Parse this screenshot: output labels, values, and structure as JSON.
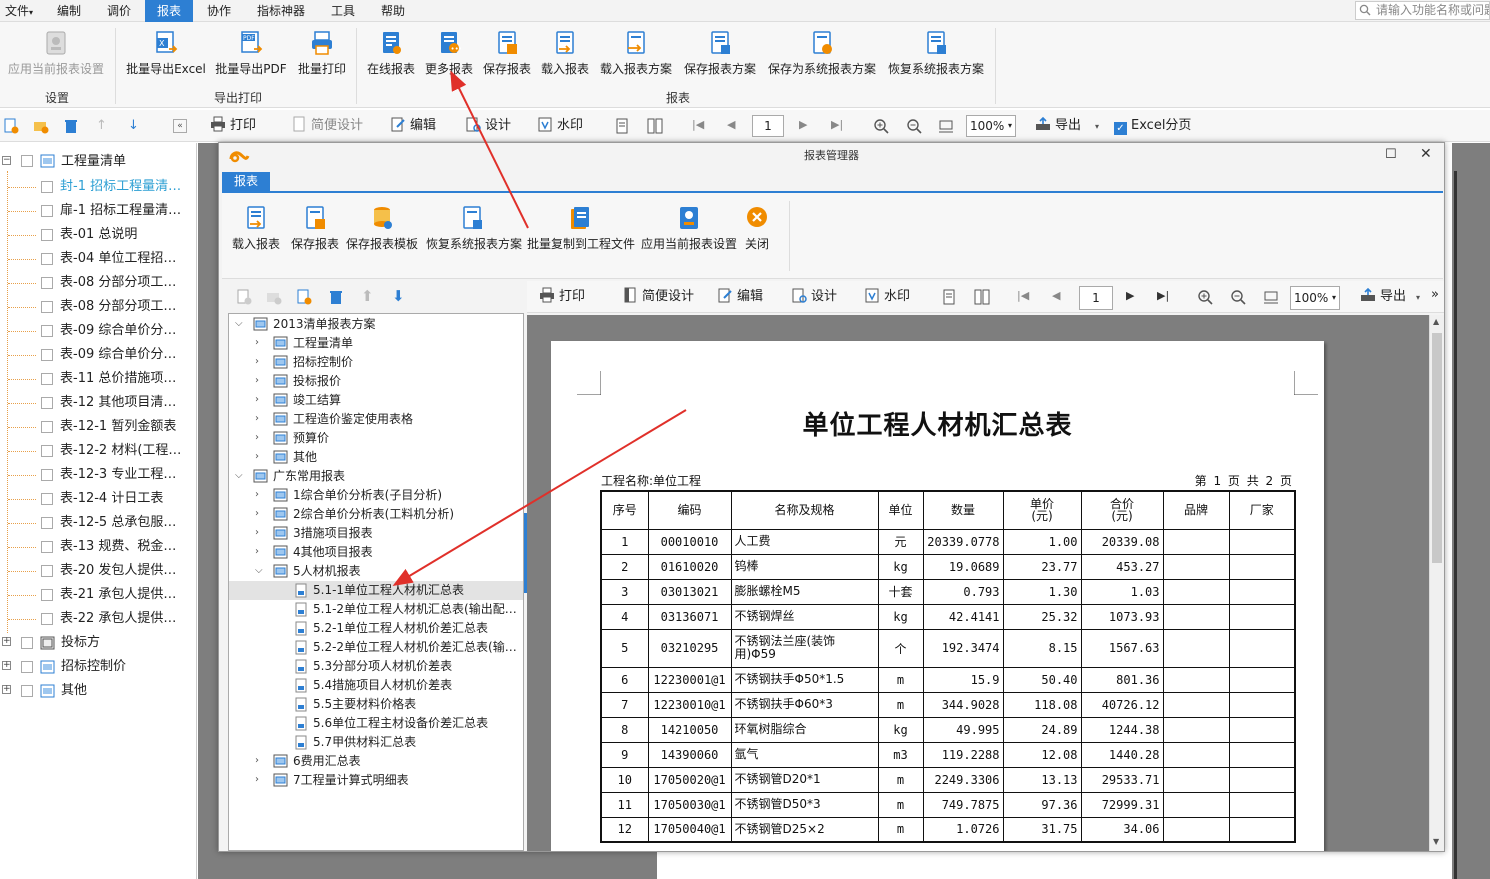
{
  "menu": {
    "file": "文件",
    "items": [
      "编制",
      "调价",
      "报表",
      "协作",
      "指标神器",
      "工具",
      "帮助"
    ],
    "active_index": 2,
    "search_placeholder": "请输入功能名称或问题"
  },
  "ribbon": {
    "settings_group": {
      "label": "设置",
      "apply_current": "应用当前报表设置"
    },
    "export_group": {
      "label": "导出打印",
      "batch_excel": "批量导出Excel",
      "batch_pdf": "批量导出PDF",
      "batch_print": "批量打印"
    },
    "report_group": {
      "label": "报表",
      "online": "在线报表",
      "more": "更多报表",
      "save": "保存报表",
      "load": "载入报表",
      "load_scheme": "载入报表方案",
      "save_scheme": "保存报表方案",
      "save_sys_scheme": "保存为系统报表方案",
      "restore_sys_scheme": "恢复系统报表方案"
    }
  },
  "main_toolbar": {
    "print": "打印",
    "quick_design": "简便设计",
    "edit": "编辑",
    "design": "设计",
    "watermark": "水印",
    "page": "1",
    "zoom": "100%",
    "export": "导出",
    "excel_paging": "Excel分页",
    "excel_paging_checked": true
  },
  "left_tree": {
    "root": "工程量清单",
    "items": [
      "封-1 招标工程量清…",
      "扉-1 招标工程量清…",
      "表-01 总说明",
      "表-04 单位工程招…",
      "表-08 分部分项工…",
      "表-08 分部分项工…",
      "表-09 综合单价分…",
      "表-09 综合单价分…",
      "表-11 总价措施项…",
      "表-12 其他项目清…",
      "表-12-1 暂列金额表",
      "表-12-2 材料(工程…",
      "表-12-3 专业工程…",
      "表-12-4 计日工表",
      "表-12-5 总承包服…",
      "表-13 规费、税金…",
      "表-20 发包人提供…",
      "表-21 承包人提供…",
      "表-22 承包人提供…"
    ],
    "selected_index": 0,
    "others": [
      "投标方",
      "招标控制价",
      "其他"
    ]
  },
  "dialog": {
    "title": "报表管理器",
    "tab": "报表",
    "buttons": {
      "load": "载入报表",
      "save": "保存报表",
      "save_template": "保存报表模板",
      "restore_sys": "恢复系统报表方案",
      "batch_copy": "批量复制到工程文件",
      "apply_current": "应用当前报表设置",
      "close": "关闭"
    },
    "tree": {
      "group1": "2013清单报表方案",
      "group1_items": [
        "工程量清单",
        "招标控制价",
        "投标报价",
        "竣工结算",
        "工程造价鉴定使用表格",
        "预算价",
        "其他"
      ],
      "group2": "广东常用报表",
      "group2_items": [
        "1综合单价分析表(子目分析)",
        "2综合单价分析表(工料机分析)",
        "3措施项目报表",
        "4其他项目报表",
        "5人材机报表"
      ],
      "group2_sub": [
        "5.1-1单位工程人材机汇总表",
        "5.1-2单位工程人材机汇总表(输出配…",
        "5.2-1单位工程人材机价差汇总表",
        "5.2-2单位工程人材机价差汇总表(输…",
        "5.3分部分项人材机价差表",
        "5.4措施项目人材机价差表",
        "5.5主要材料价格表",
        "5.6单位工程主材设备价差汇总表",
        "5.7甲供材料汇总表"
      ],
      "group2_tail": [
        "6费用汇总表",
        "7工程量计算式明细表"
      ],
      "selected_sub_index": 0
    },
    "preview_toolbar": {
      "print": "打印",
      "quick_design": "简便设计",
      "edit": "编辑",
      "design": "设计",
      "watermark": "水印",
      "page": "1",
      "zoom": "100%",
      "export": "导出",
      "more": "»"
    }
  },
  "report": {
    "title": "单位工程人材机汇总表",
    "project_label": "工程名称:单位工程",
    "page_info": "第 1 页  共 2 页",
    "headers": [
      "序号",
      "编码",
      "名称及规格",
      "单位",
      "数量",
      "单价\n(元)",
      "合价\n(元)",
      "品牌",
      "厂家"
    ],
    "rows": [
      [
        "1",
        "00010010",
        "人工费",
        "元",
        "20339.0778",
        "1.00",
        "20339.08",
        "",
        ""
      ],
      [
        "2",
        "01610020",
        "钨棒",
        "kg",
        "19.0689",
        "23.77",
        "453.27",
        "",
        ""
      ],
      [
        "3",
        "03013021",
        "膨胀螺栓M5",
        "十套",
        "0.793",
        "1.30",
        "1.03",
        "",
        ""
      ],
      [
        "4",
        "03136071",
        "不锈钢焊丝",
        "kg",
        "42.4141",
        "25.32",
        "1073.93",
        "",
        ""
      ],
      [
        "5",
        "03210295",
        "不锈钢法兰座(装饰用)Φ59",
        "个",
        "192.3474",
        "8.15",
        "1567.63",
        "",
        ""
      ],
      [
        "6",
        "12230001@1",
        "不锈钢扶手Φ50*1.5",
        "m",
        "15.9",
        "50.40",
        "801.36",
        "",
        ""
      ],
      [
        "7",
        "12230010@1",
        "不锈钢扶手Φ60*3",
        "m",
        "344.9028",
        "118.08",
        "40726.12",
        "",
        ""
      ],
      [
        "8",
        "14210050",
        "环氧树脂综合",
        "kg",
        "49.995",
        "24.89",
        "1244.38",
        "",
        ""
      ],
      [
        "9",
        "14390060",
        "氩气",
        "m3",
        "119.2288",
        "12.08",
        "1440.28",
        "",
        ""
      ],
      [
        "10",
        "17050020@1",
        "不锈钢管D20*1",
        "m",
        "2249.3306",
        "13.13",
        "29533.71",
        "",
        ""
      ],
      [
        "11",
        "17050030@1",
        "不锈钢管D50*3",
        "m",
        "749.7875",
        "97.36",
        "72999.31",
        "",
        ""
      ],
      [
        "12",
        "17050040@1",
        "不锈钢管D25×2",
        "m",
        "1.0726",
        "31.75",
        "34.06",
        "",
        ""
      ]
    ]
  },
  "colors": {
    "accent": "#2d7fd3",
    "arrow": "#e0302a",
    "selected_text": "#2d9fd3"
  }
}
